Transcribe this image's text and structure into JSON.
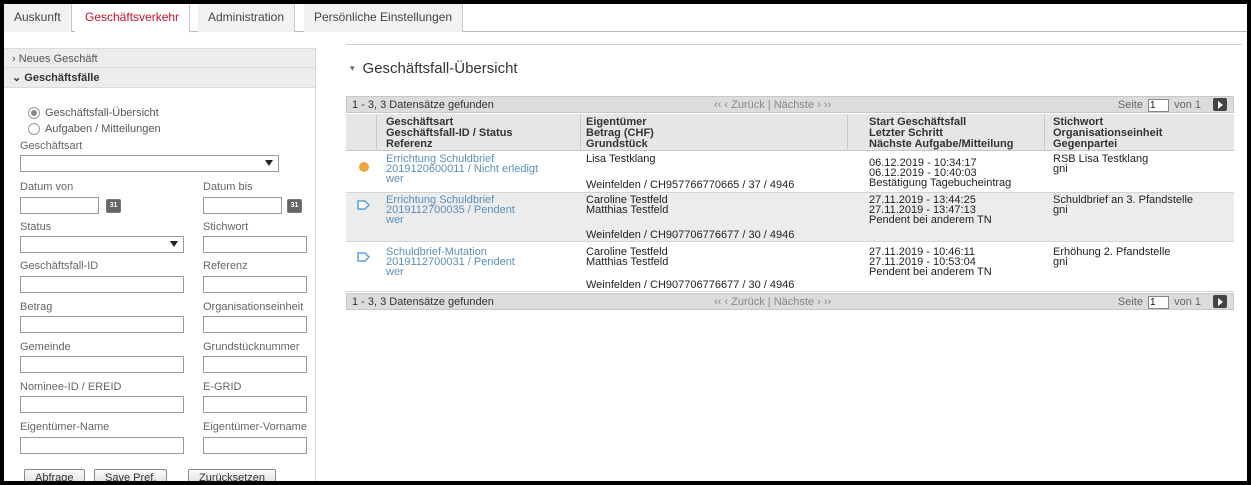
{
  "tabs": [
    "Auskunft",
    "Geschäftsverkehr",
    "Administration",
    "Persönliche Einstellungen"
  ],
  "sidebar": {
    "neues_geschaeft": "› Neues Geschäft",
    "geschaeftsfaelle": "⌄ Geschäftsfälle",
    "radio_uebersicht": "Geschäftsfall-Übersicht",
    "radio_aufgaben": "Aufgaben / Mitteilungen",
    "labels": {
      "geschaeftsart": "Geschäftsart",
      "datum_von": "Datum von",
      "datum_bis": "Datum bis",
      "status": "Status",
      "stichwort": "Stichwort",
      "geschaeftsfall_id": "Geschäftsfall-ID",
      "referenz": "Referenz",
      "betrag": "Betrag",
      "organisationseinheit": "Organisationseinheit",
      "gemeinde": "Gemeinde",
      "grundstuecknummer": "Grundstücknummer",
      "nominee_id": "Nominee-ID / EREID",
      "egrid": "E-GRID",
      "eigentuemer_name": "Eigentümer-Name",
      "eigentuemer_vorname": "Eigentümer-Vorname"
    },
    "calendar_icon_text": "31",
    "buttons": {
      "abfrage": "Abfrage",
      "save": "Save Pref.",
      "reset": "Zurücksetzen"
    }
  },
  "main": {
    "title": "Geschäftsfall-Übersicht",
    "pager": {
      "count": "1 - 3, 3 Datensätze gefunden",
      "nav": "‹‹   ‹ Zurück  |  Nächste ›   ››",
      "seite": "Seite",
      "page": "1",
      "von": "von 1"
    },
    "columns": [
      [
        "Geschäftsart",
        "Geschäftsfall-ID / Status",
        "Referenz"
      ],
      [
        "Eigentümer",
        "Betrag (CHF)",
        "Grundstück"
      ],
      [
        "Start Geschäftsfall",
        "Letzter Schritt",
        "Nächste Aufgabe/Mitteilung"
      ],
      [
        "Stichwort",
        "Organisationseinheit",
        "Gegenpartei"
      ]
    ],
    "rows": [
      {
        "icon": "status-dot-orange",
        "art": "Errichtung Schuldbrief",
        "id_status": "2019120600011 / Nicht erledigt",
        "referenz": "wer",
        "eigentuemer1": "Lisa Testklang",
        "eigentuemer2": "",
        "grundstueck": "Weinfelden / CH957766770665 / 37 / 4946",
        "start": "06.12.2019 - 10:34:17",
        "letzter": "06.12.2019 - 10:40:03",
        "naechste": "Bestätigung Tagebucheintrag",
        "stichwort": "RSB Lisa Testklang",
        "org": "gni"
      },
      {
        "icon": "status-arrow-blue",
        "art": "Errichtung Schuldbrief",
        "id_status": "2019112700035 / Pendent",
        "referenz": "wer",
        "eigentuemer1": "Caroline Testfeld",
        "eigentuemer2": "Matthias Testfeld",
        "grundstueck": "Weinfelden / CH907706776677 / 30 / 4946",
        "start": "27.11.2019 - 13:44:25",
        "letzter": "27.11.2019 - 13:47:13",
        "naechste": "Pendent bei anderem TN",
        "stichwort": "Schuldbrief an 3. Pfandstelle",
        "org": "gni"
      },
      {
        "icon": "status-arrow-blue",
        "art": "Schuldbrief-Mutation",
        "id_status": "2019112700031 / Pendent",
        "referenz": "wer",
        "eigentuemer1": "Caroline Testfeld",
        "eigentuemer2": "Matthias Testfeld",
        "grundstueck": "Weinfelden / CH907706776677 / 30 / 4946",
        "start": "27.11.2019 - 10:46:11",
        "letzter": "27.11.2019 - 10:53:04",
        "naechste": "Pendent bei anderem TN",
        "stichwort": "Erhöhung 2. Pfandstelle",
        "org": "gni"
      }
    ]
  },
  "colors": {
    "active_tab": "#c8102e",
    "link": "#5b8fb9",
    "orange_dot": "#f0a53a",
    "blue_arrow": "#5ba3d0"
  }
}
